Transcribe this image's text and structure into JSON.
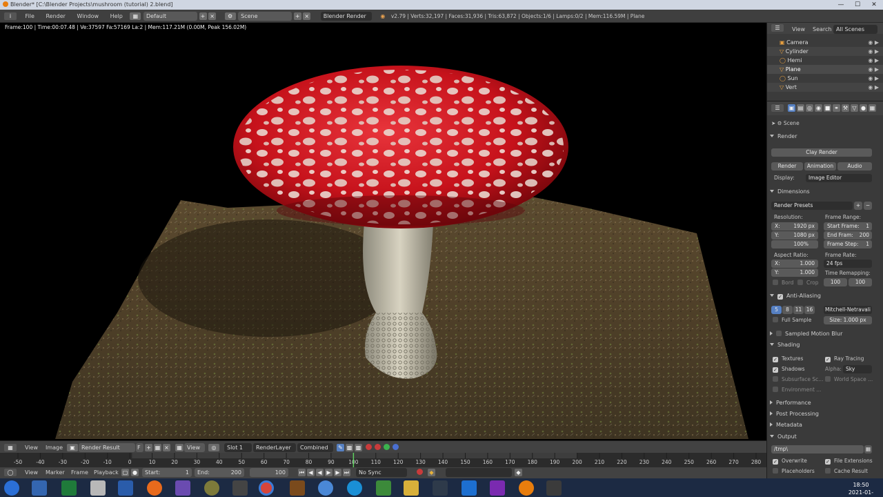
{
  "window": {
    "title": "Blender* [C:\\Blender Projects\\mushroom (tutorial) 2.blend]"
  },
  "info_header": {
    "menus": [
      "File",
      "Render",
      "Window",
      "Help"
    ],
    "screen_layout": "Default",
    "scene": "Scene",
    "engine": "Blender Render",
    "stats": "v2.79 | Verts:32,197 | Faces:31,936 | Tris:63,872 | Objects:1/6 | Lamps:0/2 | Mem:116.59M | Plane"
  },
  "render_info": "Frame:100 | Time:00:07.48 | Ve:37597 Fa:57169 La:2 | Mem:117.21M (0.00M, Peak 156.02M)",
  "image_editor_header": {
    "menus": [
      "View",
      "Image"
    ],
    "image_name": "Render Result",
    "image_flag": "F",
    "view_label": "View",
    "slot": "Slot 1",
    "render_layer": "RenderLayer",
    "pass": "Combined"
  },
  "timeline": {
    "ruler": [
      "-50",
      "-40",
      "-30",
      "-20",
      "-10",
      "0",
      "10",
      "20",
      "30",
      "40",
      "50",
      "60",
      "70",
      "80",
      "90",
      "100",
      "110",
      "120",
      "130",
      "140",
      "150",
      "160",
      "170",
      "180",
      "190",
      "200",
      "210",
      "220",
      "230",
      "240",
      "250",
      "260",
      "270",
      "280"
    ],
    "current_frame": 100,
    "menus": [
      "View",
      "Marker",
      "Frame",
      "Playback"
    ],
    "start_label": "Start:",
    "start_value": "1",
    "end_label": "End:",
    "end_value": "200",
    "frame_value": "100",
    "sync": "No Sync"
  },
  "outliner": {
    "header_view": "View",
    "header_search": "Search",
    "header_filter": "All Scenes",
    "items": [
      "Camera",
      "Cylinder",
      "Hemi",
      "Plane",
      "Sun",
      "Vert"
    ]
  },
  "properties": {
    "scene_label": "Scene",
    "render_panel": "Render",
    "clay_render": "Clay Render",
    "render_btn": "Render",
    "animation_btn": "Animation",
    "audio_btn": "Audio",
    "display_label": "Display:",
    "display_value": "Image Editor",
    "dimensions_panel": "Dimensions",
    "render_presets": "Render Presets",
    "resolution_label": "Resolution:",
    "res_x": "X:",
    "res_x_val": "1920 px",
    "res_y": "Y:",
    "res_y_val": "1080 px",
    "res_pct": "100%",
    "frame_range_label": "Frame Range:",
    "start_frame": "Start Frame:",
    "start_frame_val": "1",
    "end_frame": "End Fram:",
    "end_frame_val": "200",
    "frame_step": "Frame Step:",
    "frame_step_val": "1",
    "aspect_label": "Aspect Ratio:",
    "aspect_x": "X:",
    "aspect_x_val": "1.000",
    "aspect_y": "Y:",
    "aspect_y_val": "1.000",
    "frame_rate_label": "Frame Rate:",
    "fps": "24 fps",
    "time_remap_label": "Time Remapping:",
    "remap_old": "100",
    "remap_new": "100",
    "border": "Bord",
    "crop": "Crop",
    "aa_panel": "Anti-Aliasing",
    "aa_samples": [
      "5",
      "8",
      "11",
      "16"
    ],
    "aa_filter": "Mitchell-Netravali",
    "full_sample": "Full Sample",
    "aa_size": "Size: 1.000 px",
    "motion_blur_panel": "Sampled Motion Blur",
    "shading_panel": "Shading",
    "textures": "Textures",
    "ray_tracing": "Ray Tracing",
    "shadows": "Shadows",
    "alpha_label": "Alpha:",
    "alpha_value": "Sky",
    "subsurface": "Subsurface Sc...",
    "world_space": "World Space ...",
    "environment": "Environment ...",
    "performance_panel": "Performance",
    "post_processing_panel": "Post Processing",
    "metadata_panel": "Metadata",
    "output_panel": "Output",
    "output_path": "/tmp\\",
    "overwrite": "Overwrite",
    "file_extensions": "File Extensions",
    "placeholders": "Placeholders",
    "cache_result": "Cache Result"
  },
  "taskbar": {
    "time": "18:50",
    "date": "2021-01-30"
  },
  "colors": {
    "accent_blue": "#5680c2",
    "cap_red": "#d61820",
    "header_grey": "#424242",
    "taskbar": "#1c2a43"
  }
}
